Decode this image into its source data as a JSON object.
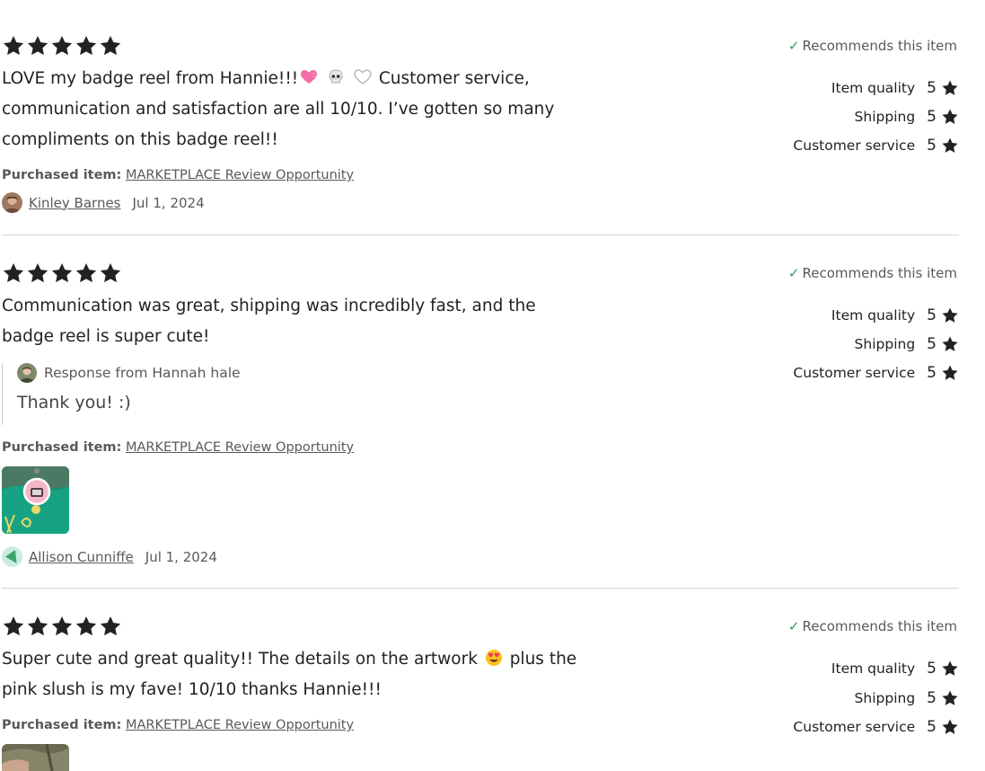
{
  "top_partial_text": "· · · · · · · · · · ·",
  "colors": {
    "text": "#222222",
    "muted": "#595959",
    "check": "#2e9e58",
    "divider": "#d5d5d5"
  },
  "reviews": [
    {
      "stars": 5,
      "text_parts": [
        "LOVE my badge reel from Hannie!!!",
        "Customer service, communication and satisfaction are all 10/10. I’ve gotten so many compliments on this badge reel!!"
      ],
      "emojis": [
        "pink-heart",
        "skull",
        "white-heart"
      ],
      "recommend": "Recommends this item",
      "ratings": [
        {
          "label": "Item quality",
          "value": "5"
        },
        {
          "label": "Shipping",
          "value": "5"
        },
        {
          "label": "Customer service",
          "value": "5"
        }
      ],
      "purchased_label": "Purchased item:",
      "purchased_item": "MARKETPLACE Review Opportunity",
      "author": "Kinley Barnes",
      "date": "Jul 1, 2024"
    },
    {
      "stars": 5,
      "text": "Communication was great, shipping was incredibly fast, and the badge reel is super cute!",
      "response_from": "Response from Hannah hale",
      "response_text": "Thank you! :)",
      "recommend": "Recommends this item",
      "ratings": [
        {
          "label": "Item quality",
          "value": "5"
        },
        {
          "label": "Shipping",
          "value": "5"
        },
        {
          "label": "Customer service",
          "value": "5"
        }
      ],
      "purchased_label": "Purchased item:",
      "purchased_item": "MARKETPLACE Review Opportunity",
      "photo": "badge-reel-photo",
      "author": "Allison Cunniffe",
      "date": "Jul 1, 2024"
    },
    {
      "stars": 5,
      "text_parts": [
        "Super cute and great quality!! The details on the artwork",
        "plus the pink slush is my fave! 10/10 thanks Hannie!!!"
      ],
      "emojis": [
        "heart-eyes"
      ],
      "recommend": "Recommends this item",
      "ratings": [
        {
          "label": "Item quality",
          "value": "5"
        },
        {
          "label": "Shipping",
          "value": "5"
        },
        {
          "label": "Customer service",
          "value": "5"
        }
      ],
      "purchased_label": "Purchased item:",
      "purchased_item": "MARKETPLACE Review Opportunity",
      "photo": "review-photo"
    }
  ]
}
